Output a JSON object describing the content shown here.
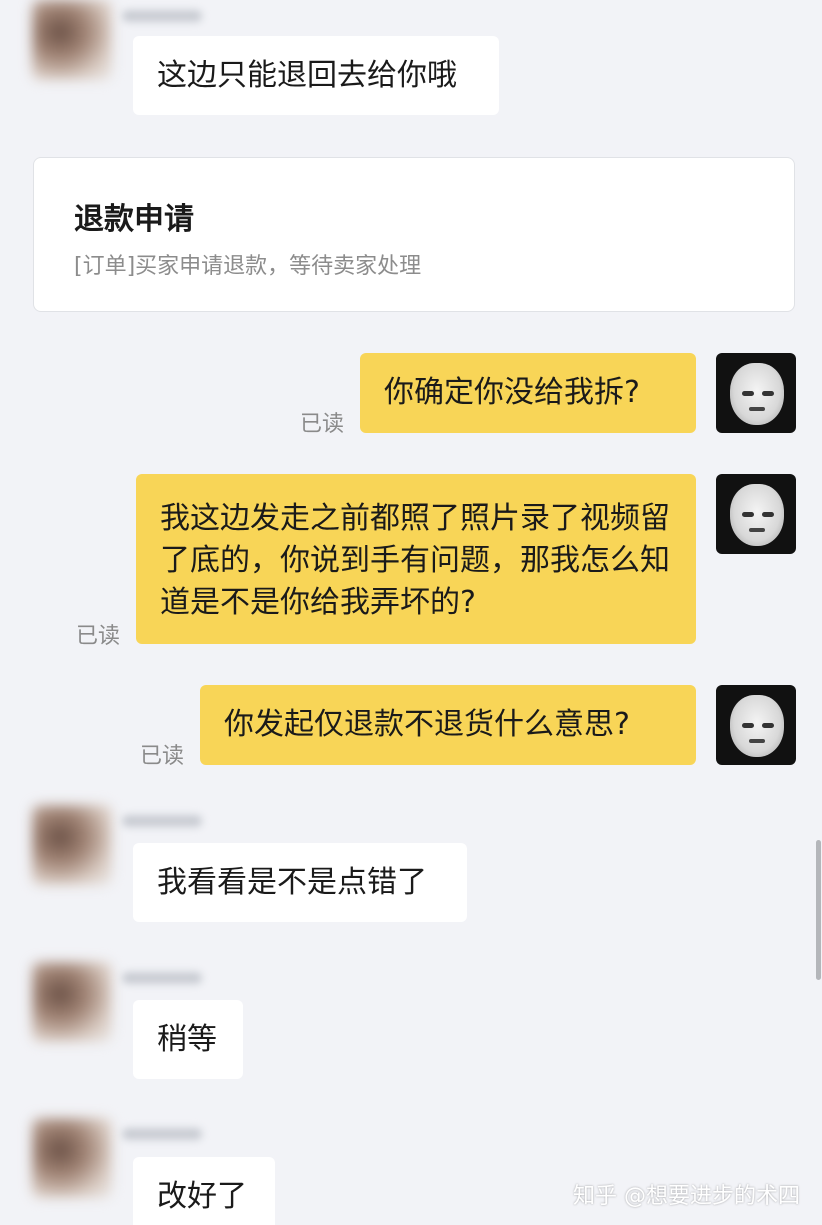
{
  "messages": {
    "m1": "这边只能退回去给你哦",
    "m2": "你确定你没给我拆?",
    "m3": "我这边发走之前都照了照片录了视频留了底的，你说到手有问题，那我怎么知道是不是你给我弄坏的?",
    "m4": "你发起仅退款不退货什么意思?",
    "m5": "我看看是不是点错了",
    "m6": "稍等",
    "m7": "改好了"
  },
  "read_label": "已读",
  "refund_card": {
    "title": "退款申请",
    "description": "[订单]买家申请退款，等待卖家处理"
  },
  "watermark": "知乎 @想要进步的术四",
  "colors": {
    "background": "#f2f3f7",
    "outgoing_bubble": "#f8d557",
    "incoming_bubble": "#ffffff"
  },
  "icons": {
    "contact_avatar": "blurred-photo-avatar",
    "self_avatar": "meme-face-avatar"
  }
}
